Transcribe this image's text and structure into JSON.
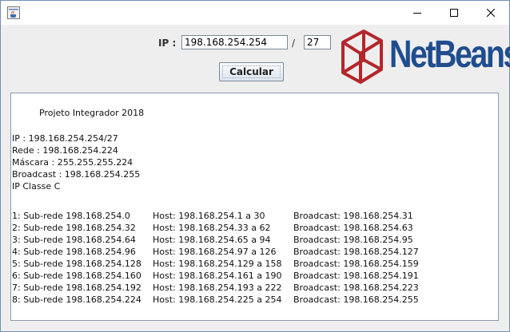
{
  "window": {
    "buttons": {
      "minimize": "minimize",
      "maximize": "maximize",
      "close": "close"
    }
  },
  "form": {
    "ip_label": "IP :",
    "ip_value": "198.168.254.254",
    "slash": "/",
    "mask_value": "27",
    "calc_label": "Calcular"
  },
  "logo": {
    "text": "NetBeans"
  },
  "output": {
    "title": "Projeto Integrador 2018",
    "info": [
      "IP : 198.168.254.254/27",
      "Rede : 198.168.254.224",
      "Máscara : 255.255.255.224",
      "Broadcast : 198.168.254.255",
      "IP Classe C"
    ],
    "subnets": [
      {
        "subnet": "1: Sub-rede 198.168.254.0",
        "host": "Host: 198.168.254.1 a 30",
        "broadcast": "Broadcast: 198.168.254.31"
      },
      {
        "subnet": "2: Sub-rede 198.168.254.32",
        "host": "Host: 198.168.254.33 a 62",
        "broadcast": "Broadcast: 198.168.254.63"
      },
      {
        "subnet": "3: Sub-rede 198.168.254.64",
        "host": "Host: 198.168.254.65 a 94",
        "broadcast": "Broadcast: 198.168.254.95"
      },
      {
        "subnet": "4: Sub-rede 198.168.254.96",
        "host": "Host: 198.168.254.97 a 126",
        "broadcast": "Broadcast: 198.168.254.127"
      },
      {
        "subnet": "5: Sub-rede 198.168.254.128",
        "host": "Host: 198.168.254.129 a 158",
        "broadcast": "Broadcast: 198.168.254.159"
      },
      {
        "subnet": "6: Sub-rede 198.168.254.160",
        "host": "Host: 198.168.254.161 a 190",
        "broadcast": "Broadcast: 198.168.254.191"
      },
      {
        "subnet": "7: Sub-rede 198.168.254.192",
        "host": "Host: 198.168.254.193 a 222",
        "broadcast": "Broadcast: 198.168.254.223"
      },
      {
        "subnet": "8: Sub-rede 198.168.254.224",
        "host": "Host: 198.168.254.225 a 254",
        "broadcast": "Broadcast: 198.168.254.255"
      }
    ]
  },
  "colors": {
    "logo_blue": "#1f4d8f",
    "logo_red": "#b3262b"
  }
}
